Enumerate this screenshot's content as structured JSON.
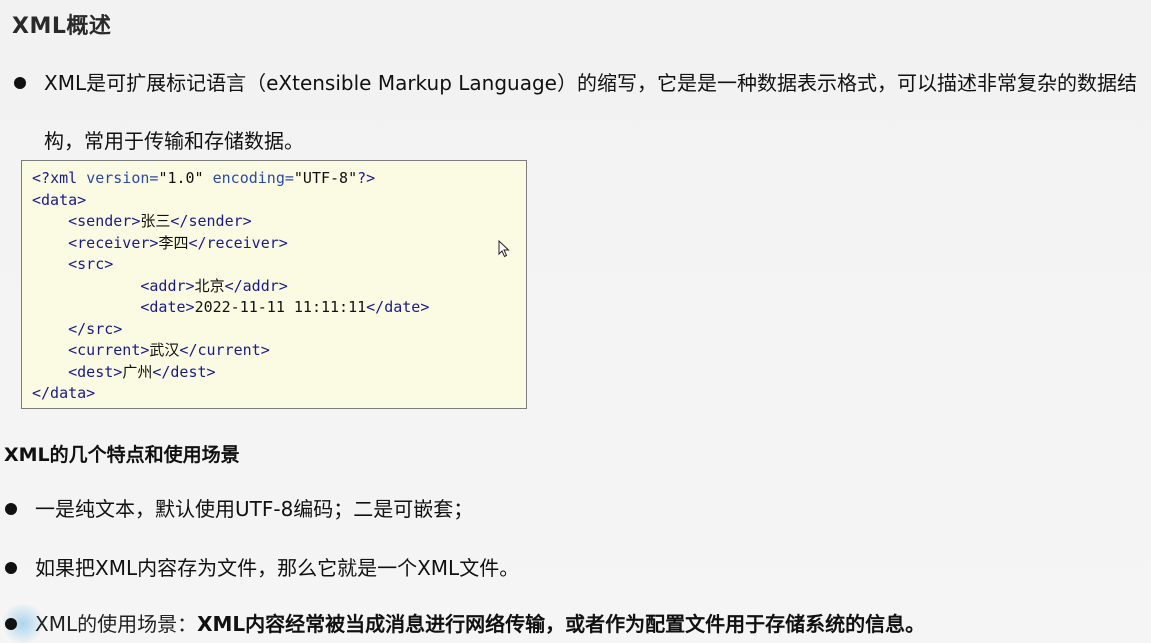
{
  "title": "XML概述",
  "intro": {
    "text": "XML是可扩展标记语言（eXtensible Markup Language）的缩写，它是是一种数据表示格式，可以描述非常复杂的数据结构，常用于传输和存储数据。"
  },
  "code": {
    "lines": [
      {
        "indent": "",
        "parts": [
          [
            "pi",
            "<?"
          ],
          [
            "tag",
            "xml "
          ],
          [
            "attr",
            "version="
          ],
          [
            "val",
            "\"1.0\" "
          ],
          [
            "attr",
            "encoding="
          ],
          [
            "val",
            "\"UTF-8\""
          ],
          [
            "pi",
            "?>"
          ]
        ]
      },
      {
        "indent": "",
        "parts": [
          [
            "tag",
            "<data>"
          ]
        ]
      },
      {
        "indent": "    ",
        "parts": [
          [
            "tag",
            "<sender>"
          ],
          [
            "txt",
            "张三"
          ],
          [
            "tag",
            "</sender>"
          ]
        ]
      },
      {
        "indent": "    ",
        "parts": [
          [
            "tag",
            "<receiver>"
          ],
          [
            "txt",
            "李四"
          ],
          [
            "tag",
            "</receiver>"
          ]
        ]
      },
      {
        "indent": "    ",
        "parts": [
          [
            "tag",
            "<src>"
          ]
        ]
      },
      {
        "indent": "            ",
        "parts": [
          [
            "tag",
            "<addr>"
          ],
          [
            "txt",
            "北京"
          ],
          [
            "tag",
            "</addr>"
          ]
        ]
      },
      {
        "indent": "            ",
        "parts": [
          [
            "tag",
            "<date>"
          ],
          [
            "txt",
            "2022-11-11 11:11:11"
          ],
          [
            "tag",
            "</date>"
          ]
        ]
      },
      {
        "indent": "    ",
        "parts": [
          [
            "tag",
            "</src>"
          ]
        ]
      },
      {
        "indent": "    ",
        "parts": [
          [
            "tag",
            "<current>"
          ],
          [
            "txt",
            "武汉"
          ],
          [
            "tag",
            "</current>"
          ]
        ]
      },
      {
        "indent": "    ",
        "parts": [
          [
            "tag",
            "<dest>"
          ],
          [
            "txt",
            "广州"
          ],
          [
            "tag",
            "</dest>"
          ]
        ]
      },
      {
        "indent": "",
        "parts": [
          [
            "tag",
            "</data>"
          ]
        ]
      }
    ]
  },
  "features": {
    "heading": "XML的几个特点和使用场景",
    "items": [
      {
        "text": "一是纯文本，默认使用UTF-8编码；二是可嵌套；"
      },
      {
        "text": "如果把XML内容存为文件，那么它就是一个XML文件。"
      },
      {
        "prefix": "XML的使用场景：",
        "strong": "XML内容经常被当成消息进行网络传输，或者作为配置文件用于存储系统的信息。"
      }
    ]
  },
  "icons": {
    "bullet": "bullet-dot-icon",
    "cursor": "mouse-pointer-icon"
  }
}
